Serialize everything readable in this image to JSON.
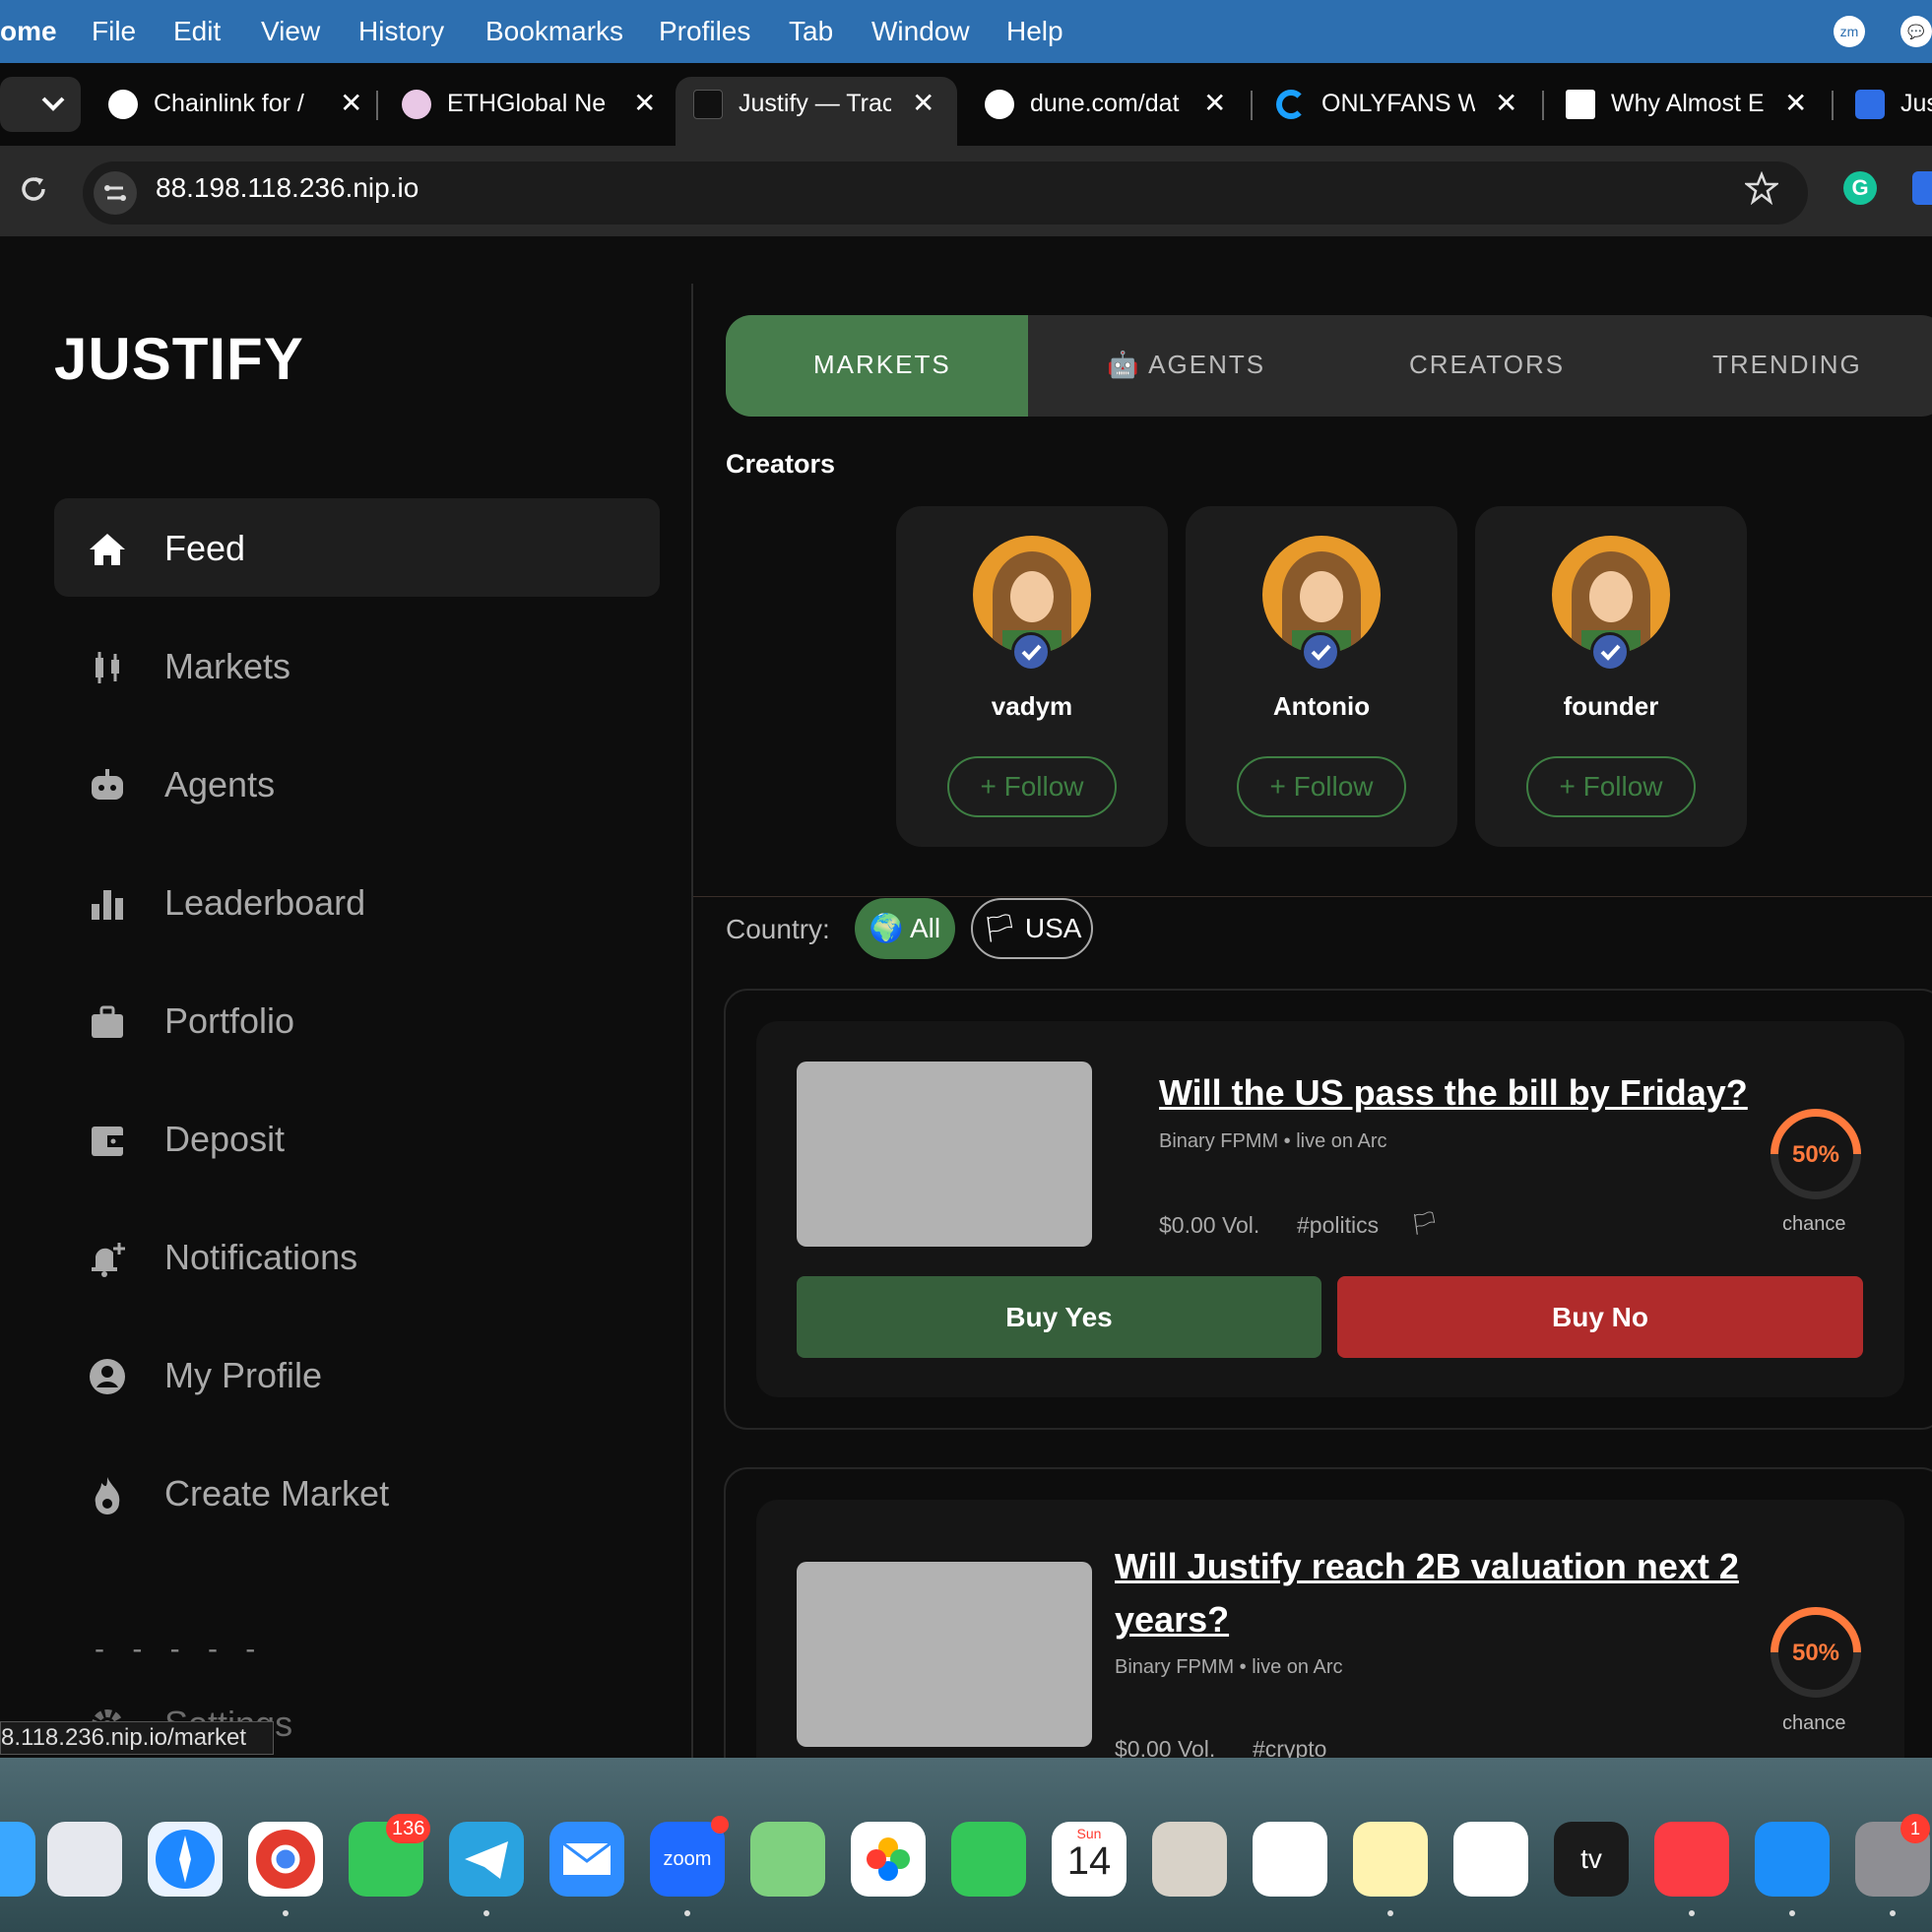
{
  "menubar": {
    "app": "ome",
    "items": [
      "File",
      "Edit",
      "View",
      "History",
      "Bookmarks",
      "Profiles",
      "Tab",
      "Window",
      "Help"
    ],
    "right_icons": [
      "zoom-icon",
      "chat-icon"
    ]
  },
  "tabs": [
    {
      "title": "Chainlink for /",
      "icon": "openai-icon"
    },
    {
      "title": "ETHGlobal Ne",
      "icon": "ethglobal-icon"
    },
    {
      "title": "Justify — Trac",
      "icon": "justify-icon",
      "active": true
    },
    {
      "title": "dune.com/dat",
      "icon": "dune-icon"
    },
    {
      "title": "ONLYFANS W",
      "icon": "c-icon"
    },
    {
      "title": "Why Almost E",
      "icon": "wsj-icon"
    },
    {
      "title": "Jus",
      "icon": "gear-blue-icon"
    }
  ],
  "address_bar": {
    "url": "88.198.118.236.nip.io"
  },
  "app": {
    "logo": "JUSTIFY",
    "nav": [
      {
        "label": "Feed",
        "icon": "home-icon",
        "active": true
      },
      {
        "label": "Markets",
        "icon": "candlestick-icon"
      },
      {
        "label": "Agents",
        "icon": "robot-icon"
      },
      {
        "label": "Leaderboard",
        "icon": "bar-chart-icon"
      },
      {
        "label": "Portfolio",
        "icon": "briefcase-icon"
      },
      {
        "label": "Deposit",
        "icon": "wallet-icon"
      },
      {
        "label": "Notifications",
        "icon": "bell-plus-icon"
      },
      {
        "label": "My Profile",
        "icon": "user-circle-icon"
      },
      {
        "label": "Create Market",
        "icon": "fire-icon"
      },
      {
        "label": "Settings",
        "icon": "gear-icon"
      }
    ],
    "top_tabs": [
      {
        "label": "MARKETS",
        "active": true
      },
      {
        "label": "🤖 AGENTS"
      },
      {
        "label": "CREATORS"
      },
      {
        "label": "TRENDING"
      }
    ],
    "creators_title": "Creators",
    "creators": [
      {
        "name": "vadym",
        "follow": "+ Follow"
      },
      {
        "name": "Antonio",
        "follow": "+ Follow"
      },
      {
        "name": "founder",
        "follow": "+ Follow"
      }
    ],
    "country_label": "Country:",
    "country_filters": [
      {
        "label": "🌍 All",
        "active": true
      },
      {
        "label": "🏳 USA"
      }
    ],
    "markets": [
      {
        "title": "Will the US pass the bill by Friday?",
        "subtitle": "Binary FPMM • live on Arc",
        "volume": "$0.00 Vol.",
        "tag": "#politics",
        "flag": "🏳",
        "chance": "50%",
        "chance_value": 0.5,
        "chance_label": "chance",
        "buy_yes": "Buy Yes",
        "buy_no": "Buy No"
      },
      {
        "title": "Will Justify reach 2B valuation next 2 years?",
        "subtitle": "Binary FPMM • live on Arc",
        "volume": "$0.00 Vol.",
        "tag": "#crypto",
        "chance": "50%",
        "chance_value": 0.5,
        "chance_label": "chance"
      }
    ]
  },
  "status_bar": "8.118.236.nip.io/market",
  "dock": {
    "messages_badge": "136",
    "calendar_day": "Sun",
    "calendar_date": "14",
    "settings_badge": "1",
    "apps": [
      "finder-icon",
      "launchpad-icon",
      "safari-icon",
      "chrome-icon",
      "messages-icon",
      "telegram-icon",
      "mail-icon",
      "zoom-icon",
      "maps-icon",
      "photos-icon",
      "facetime-icon",
      "calendar-icon",
      "contacts-icon",
      "reminders-icon",
      "notes-icon",
      "freeform-icon",
      "appletv-icon",
      "music-icon",
      "appstore-icon",
      "settings-icon"
    ]
  },
  "colors": {
    "accent_green": "#477d4c",
    "no_red": "#b02b2b",
    "yes_green": "#365f3b",
    "gauge_orange": "#ff7a3d"
  }
}
